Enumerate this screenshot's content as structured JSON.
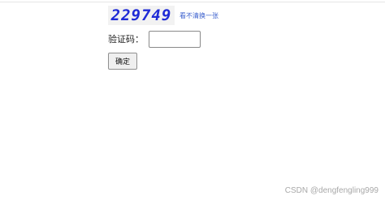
{
  "captcha": {
    "code": "229749",
    "refresh_link": "看不清换一张"
  },
  "form": {
    "label": "验证码：",
    "input_value": "",
    "confirm_label": "确定"
  },
  "watermark": {
    "text": "CSDN @dengfengling999"
  },
  "colors": {
    "captcha_text": "#1f2bd6",
    "link": "#3a5fcd",
    "watermark": "#a8a8a8"
  }
}
